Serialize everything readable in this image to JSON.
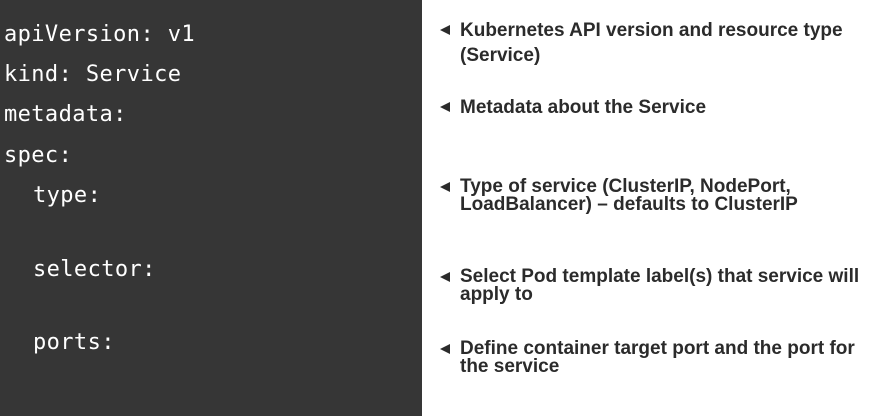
{
  "code": {
    "lines": [
      "apiVersion: v1",
      "kind: Service",
      "metadata:",
      "spec:",
      "type:",
      "selector:",
      "ports:"
    ]
  },
  "notes": [
    "Kubernetes API version and resource type (Service)",
    "Metadata about the Service",
    "Type of service (ClusterIP, NodePort, LoadBalancer) – defaults to ClusterIP",
    "Select Pod template label(s) that service will apply to",
    "Define container target port and the port for the service"
  ]
}
